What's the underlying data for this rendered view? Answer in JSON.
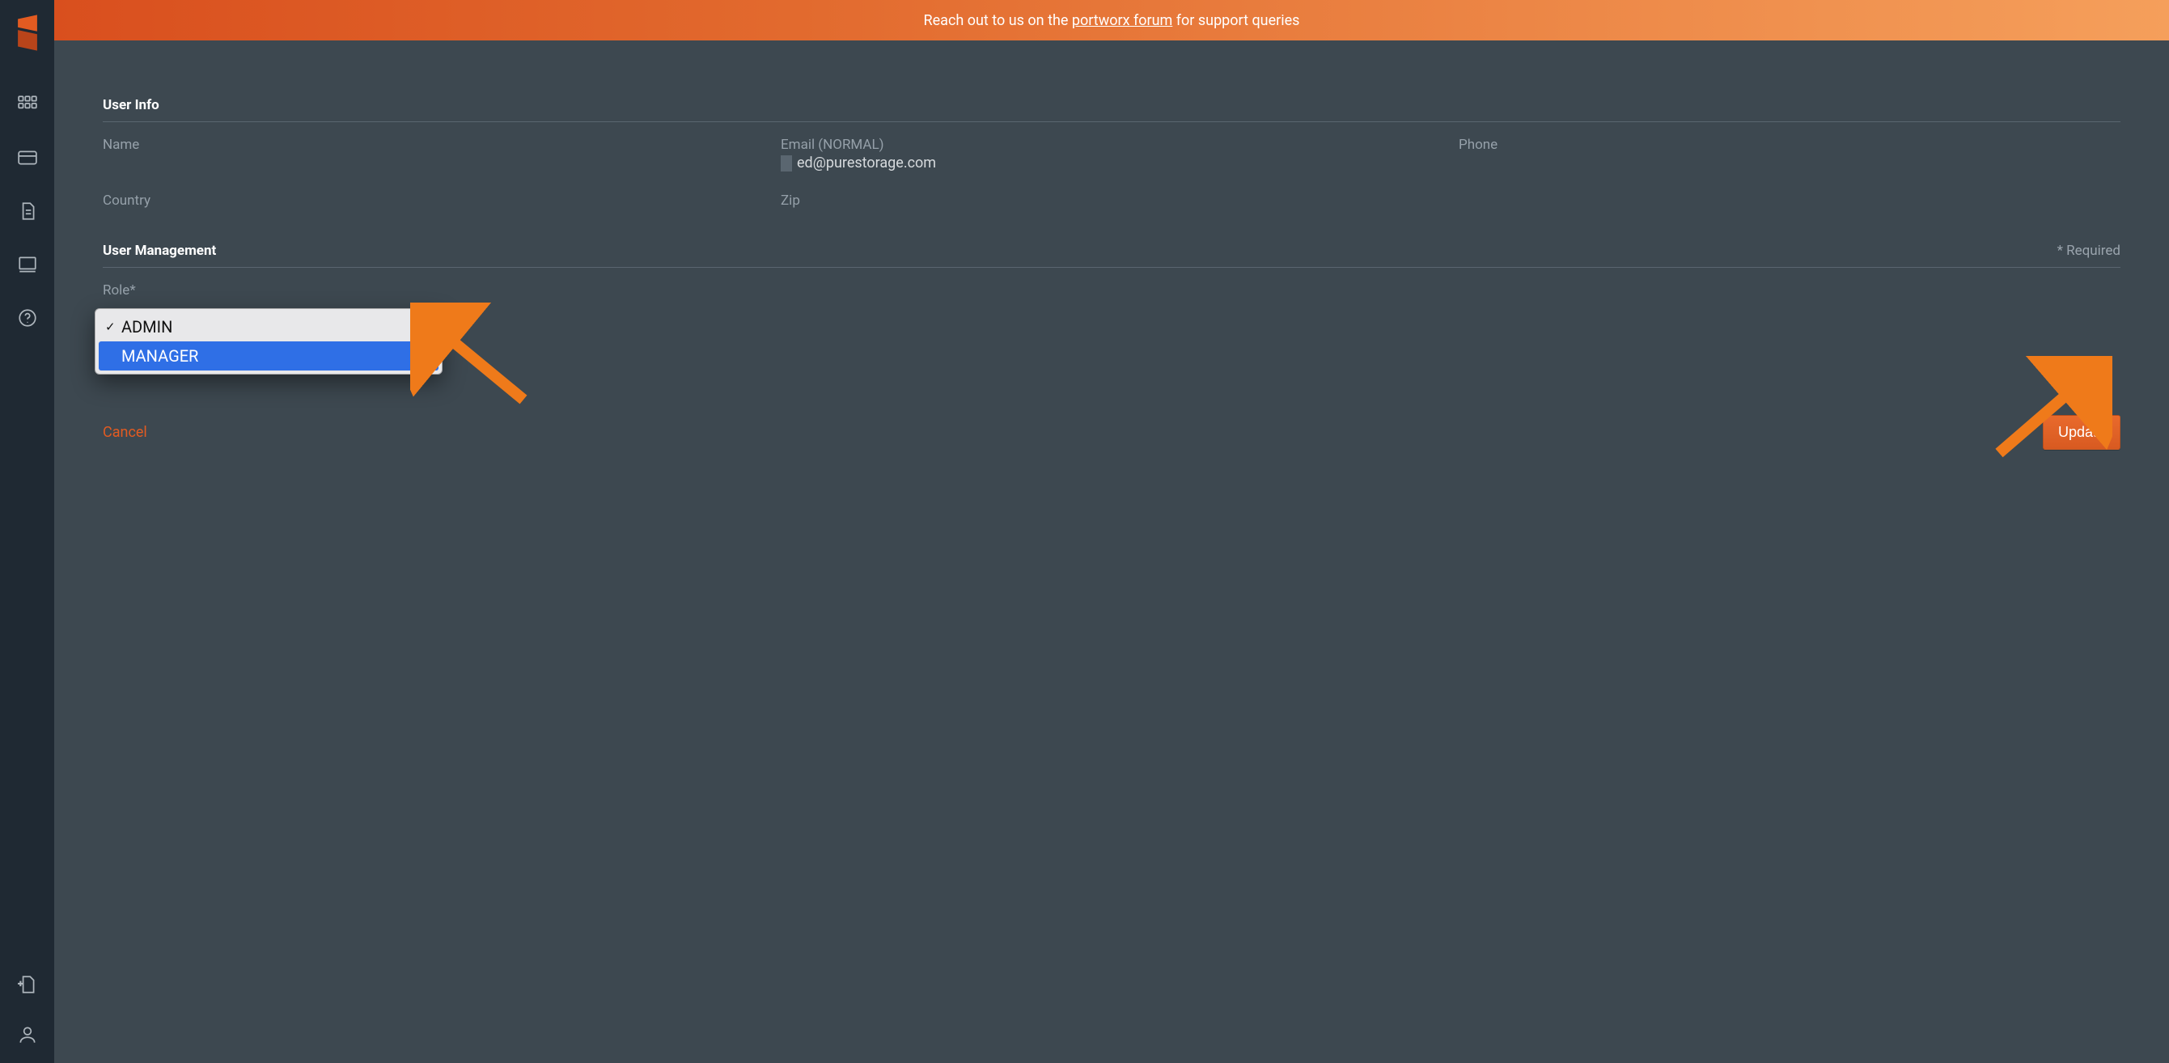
{
  "banner": {
    "prefix": "Reach out to us on the ",
    "link_text": "portworx forum",
    "suffix": " for support queries"
  },
  "sections": {
    "user_info_title": "User Info",
    "user_management_title": "User Management",
    "required_note": "* Required"
  },
  "user_info": {
    "name_label": "Name",
    "email_label": "Email (NORMAL)",
    "email_value": "ed@purestorage.com",
    "phone_label": "Phone",
    "country_label": "Country",
    "zip_label": "Zip"
  },
  "role": {
    "label": "Role*",
    "options": [
      "ADMIN",
      "MANAGER"
    ],
    "selected": "ADMIN",
    "highlighted": "MANAGER"
  },
  "actions": {
    "cancel": "Cancel",
    "update": "Update"
  },
  "colors": {
    "accent": "#e35b21",
    "sidebar_bg": "#1f2933",
    "page_bg": "#3d4850"
  }
}
